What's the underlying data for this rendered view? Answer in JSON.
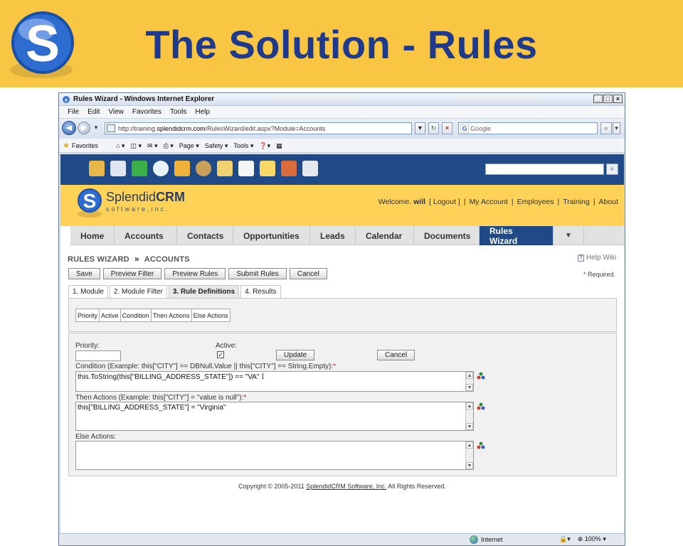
{
  "slide": {
    "title": "The Solution - Rules",
    "logo_icon": "splendid-s-logo-icon",
    "accent": "#f9c644",
    "title_color": "#1f3a8c"
  },
  "browser": {
    "window_title": "Rules Wizard - Windows Internet Explorer",
    "controls": [
      "_",
      "□",
      "×"
    ],
    "menu": [
      "File",
      "Edit",
      "View",
      "Favorites",
      "Tools",
      "Help"
    ],
    "url_prefix": "http://training.",
    "url_domain": "splendidcrm.com",
    "url_path": "/RulesWizard/edit.aspx?Module=Accounts",
    "search_placeholder": "Google",
    "favorites_label": "Favorites",
    "toolbar_items": [
      "Page ▾",
      "Safety ▾",
      "Tools ▾"
    ],
    "status_zone": "Internet",
    "zoom": "100%"
  },
  "crm": {
    "toolbar_color": "#204a87",
    "module_icons": [
      "folder-icon",
      "cards-icon",
      "dollar-icon",
      "magnifier-icon",
      "shield-icon",
      "bug-icon",
      "envelope-icon",
      "document-icon",
      "checklist-icon",
      "projector-icon",
      "phone-icon"
    ],
    "brand_left": "Splendid",
    "brand_right": "CRM",
    "brand_sub": "software,inc.",
    "welcome_prefix": "Welcome.",
    "user": "will",
    "logout": "[ Logout ]",
    "links": [
      "My Account",
      "Employees",
      "Training",
      "About"
    ],
    "tabs": [
      "Home",
      "Accounts",
      "Contacts",
      "Opportunities",
      "Leads",
      "Calendar",
      "Documents",
      "Rules Wizard"
    ],
    "active_tab": "Rules Wizard",
    "more_tab": "▼"
  },
  "wizard": {
    "breadcrumb_1": "RULES WIZARD",
    "breadcrumb_sep": "»",
    "breadcrumb_2": "ACCOUNTS",
    "help": "Help Wiki",
    "required_star": "*",
    "required": "Required.",
    "buttons": [
      "Save",
      "Preview Filter",
      "Preview Rules",
      "Submit Rules",
      "Cancel"
    ],
    "steps": [
      "1. Module",
      "2. Module Filter",
      "3. Rule Definitions",
      "4. Results"
    ],
    "active_step": "3. Rule Definitions",
    "grid_columns": [
      "Priority",
      "Active",
      "Condition",
      "Then Actions",
      "Else Actions"
    ],
    "priority_label": "Priority:",
    "priority_value": "",
    "active_label": "Active:",
    "active_check": "✓",
    "update_button": "Update",
    "cancel_button": "Cancel",
    "condition_label": "Condition (Example: this[\"CITY\"] == DBNull.Value || this[\"CITY\"] == String.Empty):",
    "condition_value": "this.ToString(this[\"BILLING_ADDRESS_STATE\"])  == \"VA\"",
    "then_label": "Then Actions (Example: this[\"CITY\"] = \"value is null\"):",
    "then_value": "this[\"BILLING_ADDRESS_STATE\"] = \"Virginia\"",
    "else_label": "Else Actions:",
    "else_value": "",
    "required_mark": "*",
    "text_cursor": "I"
  },
  "footer": {
    "prefix": "Copyright © 2005-2011 ",
    "link": "SplendidCRM Software, Inc.",
    "suffix": " All Rights Reserved."
  }
}
